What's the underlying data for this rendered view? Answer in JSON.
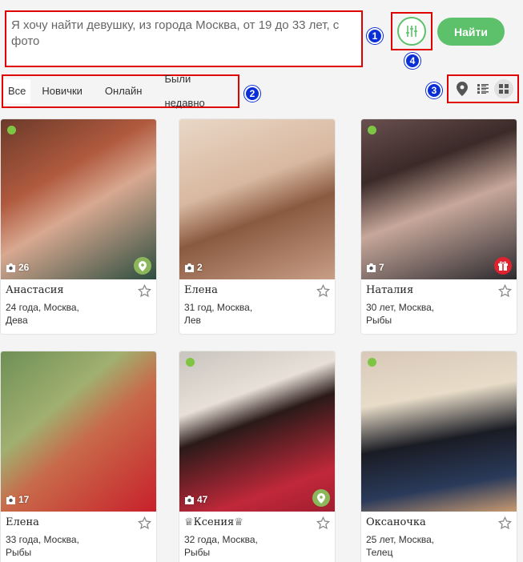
{
  "search": {
    "query": "Я хочу найти девушку, из города Москва, от 19 до 33 лет, с фото"
  },
  "find_button": "Найти",
  "badges": [
    "1",
    "2",
    "3",
    "4"
  ],
  "tabs": [
    {
      "label": "Все",
      "active": true
    },
    {
      "label": "Новички",
      "active": false
    },
    {
      "label": "Онлайн",
      "active": false
    },
    {
      "label": "Были недавно",
      "active": false
    }
  ],
  "view_modes": [
    "map-pin-icon",
    "list-icon",
    "grid-icon"
  ],
  "colors": {
    "accent": "#5cc16a",
    "highlight": "#e00000",
    "badge": "#0a2fd6",
    "online": "#7fc544",
    "gift": "#e0222f"
  },
  "profiles": [
    {
      "name": "Анастасия",
      "age_city": "24 года, Москва,",
      "sign": "Дева",
      "photos": "26",
      "corner": "location-icon"
    },
    {
      "name": "Елена",
      "age_city": "31 год, Москва,",
      "sign": "Лев",
      "photos": "2",
      "corner": ""
    },
    {
      "name": "Наталия",
      "age_city": "30 лет, Москва,",
      "sign": "Рыбы",
      "photos": "7",
      "corner": "gift-icon"
    },
    {
      "name": "Елена",
      "age_city": "33 года, Москва,",
      "sign": "Рыбы",
      "photos": "17",
      "corner": ""
    },
    {
      "name": "♕Ксения♕",
      "age_city": "32 года, Москва,",
      "sign": "Рыбы",
      "photos": "47",
      "corner": "location-icon"
    },
    {
      "name": "Оксаночка",
      "age_city": "25 лет, Москва,",
      "sign": "Телец",
      "photos": "",
      "corner": ""
    }
  ]
}
